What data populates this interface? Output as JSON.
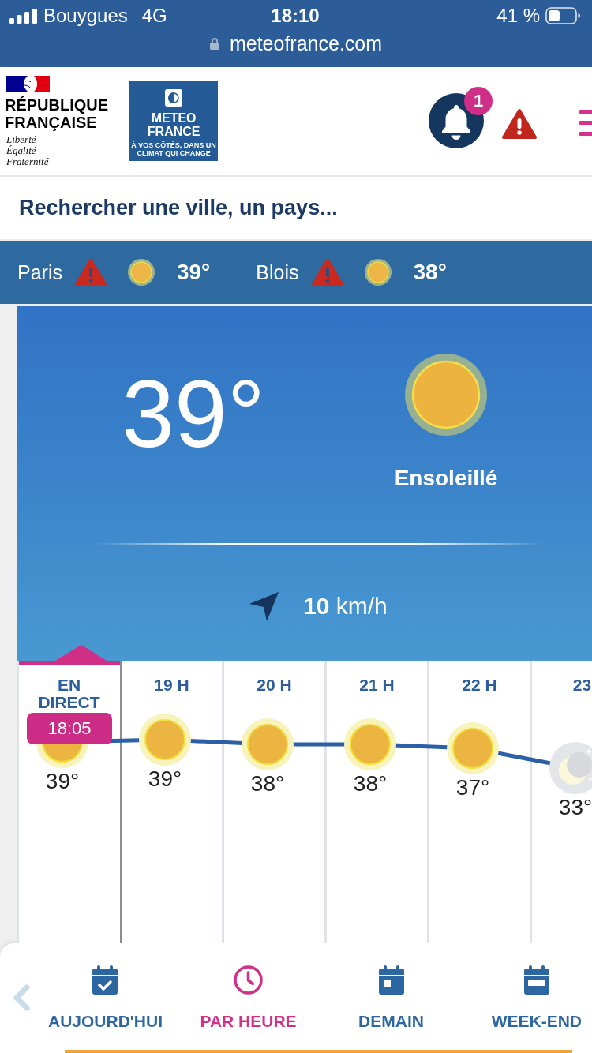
{
  "status_bar": {
    "carrier": "Bouygues",
    "network": "4G",
    "time": "18:10",
    "battery": "41 %",
    "url": "meteofrance.com"
  },
  "header": {
    "republic": "RÉPUBLIQUE FRANÇAISE",
    "motto": "Liberté Égalité Fraternité",
    "logo_title": "METEO FRANCE",
    "logo_tagline": "À VOS CÔTÉS, DANS UN CLIMAT QUI CHANGE",
    "notifications": "1"
  },
  "search": {
    "placeholder": "Rechercher une ville, un pays..."
  },
  "favorites": [
    {
      "city": "Paris",
      "alert": true,
      "kind": "sunny",
      "temperature": "39°"
    },
    {
      "city": "Blois",
      "alert": true,
      "kind": "sunny",
      "temperature": "38°"
    }
  ],
  "current": {
    "temperature": "39°",
    "kind": "sunny",
    "condition": "Ensoleillé",
    "wind": "**10** km/h"
  },
  "hours": [
    {
      "label": "EN DIRECT",
      "selected": true,
      "time": "18:05",
      "kind": "sunny",
      "temperature": "39°"
    },
    {
      "label": "19 H",
      "selected": false,
      "kind": "sunny",
      "temperature": "39°"
    },
    {
      "label": "20 H",
      "selected": false,
      "kind": "sunny",
      "temperature": "38°"
    },
    {
      "label": "21 H",
      "selected": false,
      "kind": "sunny",
      "temperature": "38°"
    },
    {
      "label": "22 H",
      "selected": false,
      "kind": "sunny",
      "temperature": "37°"
    },
    {
      "label": "23",
      "selected": false,
      "kind": "night",
      "temperature": "33°"
    }
  ],
  "nav": {
    "tabs": [
      {
        "label": "AUJOURD'HUI",
        "selected": false
      },
      {
        "label": "PAR HEURE",
        "selected": true
      },
      {
        "label": "DEMAIN",
        "selected": false
      },
      {
        "label": "WEEK-END",
        "selected": false
      }
    ]
  }
}
